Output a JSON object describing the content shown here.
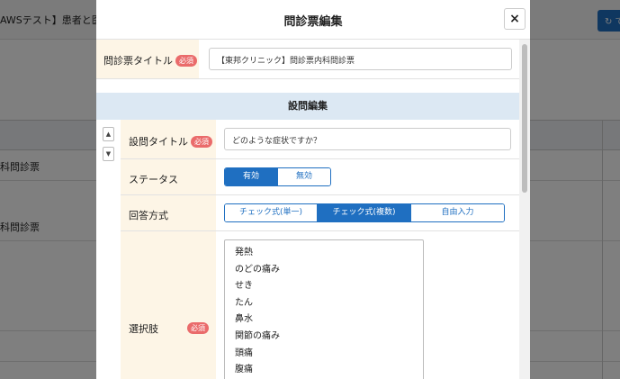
{
  "background": {
    "header_title": "AWSテスト】患者と医療",
    "header_button": "で",
    "rows": [
      "科問診票",
      "",
      "科問診票",
      "",
      "",
      "",
      ""
    ]
  },
  "modal": {
    "title": "問診票編集",
    "close_icon": "×",
    "questionnaire_title_label": "問診票タイトル",
    "required_badge": "必須",
    "questionnaire_title_value": "【東邦クリニック】問診票内科問診票",
    "section_title": "設問編集",
    "move_up_icon": "▲",
    "move_down_icon": "▼",
    "question_title_label": "設問タイトル",
    "question_title_value": "どのような症状ですか？",
    "status_label": "ステータス",
    "status_options": [
      "有効",
      "無効"
    ],
    "status_selected": "有効",
    "answer_type_label": "回答方式",
    "answer_type_options": [
      "チェック式(単一)",
      "チェック式(複数)",
      "自由入力"
    ],
    "answer_type_selected": "チェック式(複数)",
    "choices_label": "選択肢",
    "choices": [
      "発熱",
      "のどの痛み",
      "せき",
      "たん",
      "鼻水",
      "関節の痛み",
      "頭痛",
      "腹痛"
    ]
  },
  "colors": {
    "primary": "#1f6fc1",
    "required_badge": "#ea6b6b",
    "label_bg": "#fdf5e6",
    "section_bg": "#dce8f3"
  }
}
